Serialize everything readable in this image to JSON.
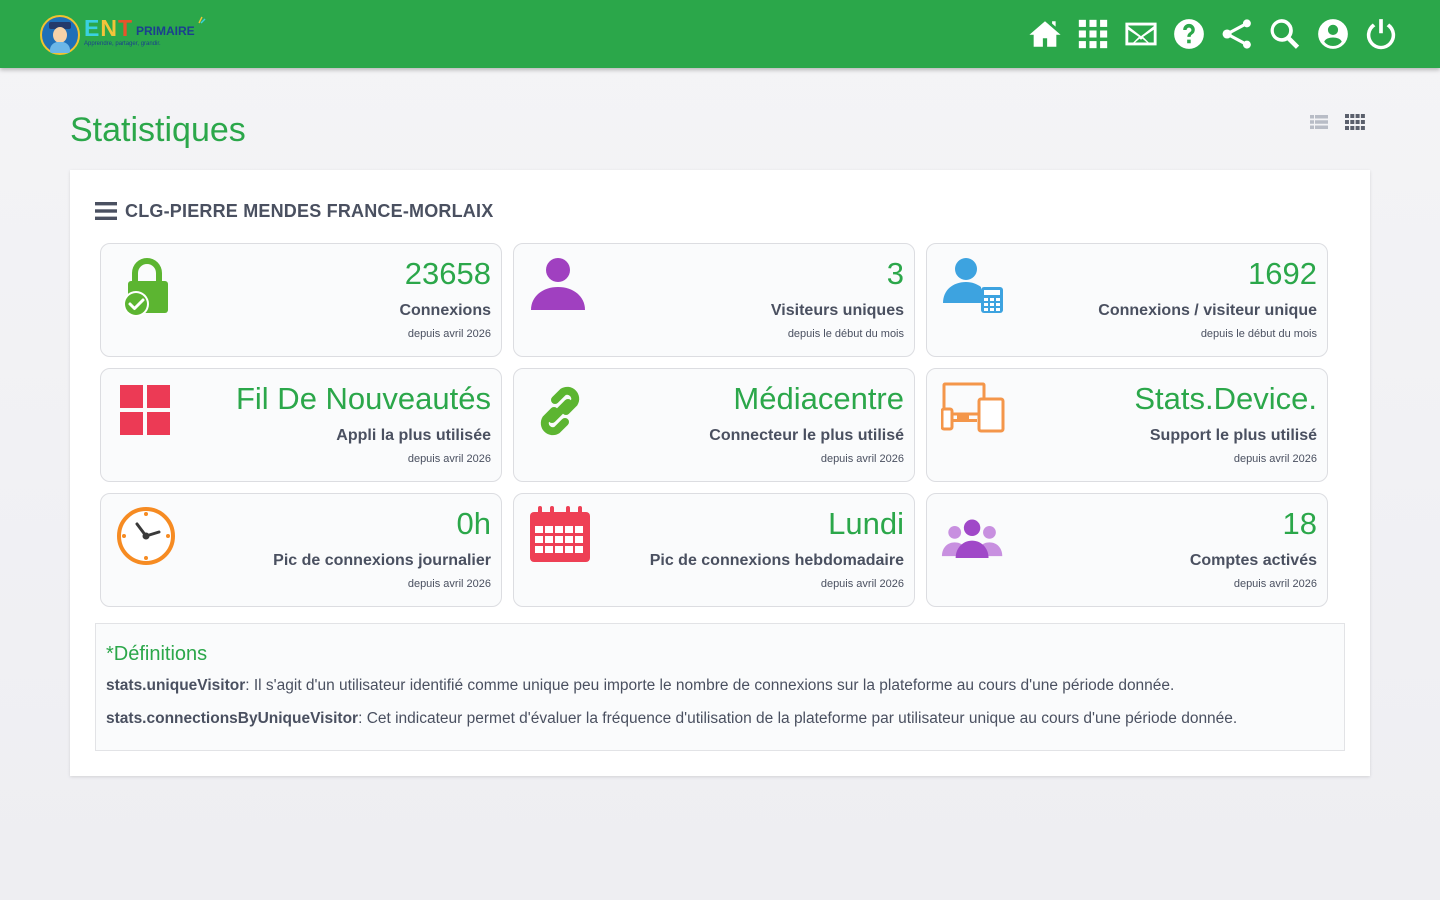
{
  "logo": {
    "ent": "ENT",
    "primaire": "PRIMAIRE",
    "tagline": "Apprendre, partager, grandir."
  },
  "nav": [
    {
      "name": "home-icon",
      "title": "Accueil"
    },
    {
      "name": "apps-icon",
      "title": "Applications"
    },
    {
      "name": "mail-icon",
      "title": "Messagerie"
    },
    {
      "name": "help-icon",
      "title": "Aide"
    },
    {
      "name": "share-icon",
      "title": "Réseau"
    },
    {
      "name": "search-icon",
      "title": "Recherche"
    },
    {
      "name": "account-icon",
      "title": "Mon compte"
    },
    {
      "name": "power-icon",
      "title": "Déconnexion"
    }
  ],
  "page": {
    "title": "Statistiques"
  },
  "panel": {
    "school": "CLG-PIERRE MENDES FRANCE-MORLAIX"
  },
  "cards": [
    {
      "icon": "padlock-check-icon",
      "value": "23658",
      "label": "Connexions",
      "since": "depuis avril 2026"
    },
    {
      "icon": "user-icon",
      "value": "3",
      "label": "Visiteurs uniques",
      "since": "depuis le début du mois"
    },
    {
      "icon": "user-calculator-icon",
      "value": "1692",
      "label": "Connexions / visiteur unique",
      "since": "depuis le début du mois"
    },
    {
      "icon": "apps-grid-icon",
      "value": "Fil De Nouveautés",
      "label": "Appli la plus utilisée",
      "since": "depuis avril 2026"
    },
    {
      "icon": "link-icon",
      "value": "Médiacentre",
      "label": "Connecteur le plus utilisé",
      "since": "depuis avril 2026"
    },
    {
      "icon": "devices-icon",
      "value": "Stats.Device.",
      "label": "Support le plus utilisé",
      "since": "depuis avril 2026"
    },
    {
      "icon": "clock-icon",
      "value": "0h",
      "label": "Pic de connexions journalier",
      "since": "depuis avril 2026"
    },
    {
      "icon": "calendar-icon",
      "value": "Lundi",
      "label": "Pic de connexions hebdomadaire",
      "since": "depuis avril 2026"
    },
    {
      "icon": "users-group-icon",
      "value": "18",
      "label": "Comptes activés",
      "since": "depuis avril 2026"
    }
  ],
  "definitions": {
    "title": "*Définitions",
    "items": [
      {
        "term": "stats.uniqueVisitor",
        "text": ":  Il s'agit d'un utilisateur identifié comme unique peu importe le nombre de connexions sur la plateforme au cours d'une période donnée."
      },
      {
        "term": "stats.connectionsByUniqueVisitor",
        "text": ":  Cet indicateur permet d'évaluer la fréquence d'utilisation de la plateforme par utilisateur unique au cours d'une période donnée."
      }
    ]
  },
  "colors": {
    "brand_green": "#2ba74a",
    "lock_green": "#5cb531",
    "user_purple": "#a040c0",
    "user_blue": "#3da3e0",
    "grid_red": "#ec3a55",
    "device_orange": "#f4964a",
    "clock_orange": "#f68b22",
    "calendar_red": "#ee4055",
    "group_purple": "#a048c8"
  }
}
